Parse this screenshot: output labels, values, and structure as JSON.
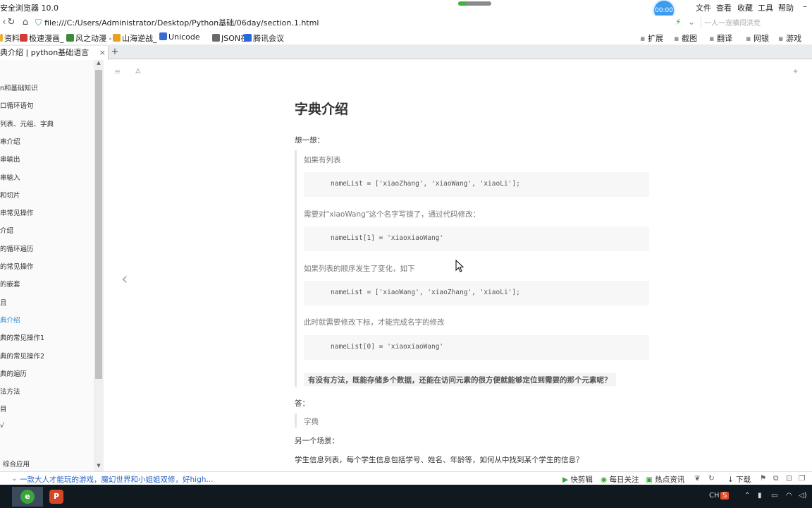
{
  "window": {
    "title": "安全浏览器 10.0",
    "timer": "00:00",
    "progress": 0.26,
    "menu": [
      "文件",
      "查看",
      "收藏",
      "工具",
      "帮助"
    ]
  },
  "nav": {
    "url": "file:///C:/Users/Administrator/Desktop/Python基础/06day/section.1.html",
    "search_placeholder": "一人一宠横闯洪荒"
  },
  "bookmarks": {
    "left": [
      {
        "label": "资料",
        "color": "#e8b22e"
      },
      {
        "label": "极速漫画_",
        "color": "#d43a3a"
      },
      {
        "label": "风之动漫 -",
        "color": "#3a8a3a"
      },
      {
        "label": "山海逆战_",
        "color": "#e8a020"
      },
      {
        "label": "Unicode",
        "color": "#3a6ad4"
      },
      {
        "label": "JSON在",
        "color": "#6a6a6a"
      },
      {
        "label": "腾讯会议",
        "color": "#2a6ad8"
      }
    ],
    "right": [
      "扩展",
      "截图",
      "翻译",
      "网银",
      "游戏"
    ]
  },
  "tab": {
    "label": "典介绍 | python基础语言",
    "close": "×",
    "new": "+"
  },
  "sidebar": {
    "items": [
      {
        "label": "n和基础知识",
        "active": false
      },
      {
        "label": "口循环语句",
        "active": false
      },
      {
        "label": "列表、元组、字典",
        "active": false
      },
      {
        "label": "串介绍",
        "active": false
      },
      {
        "label": "串输出",
        "active": false
      },
      {
        "label": "串输入",
        "active": false
      },
      {
        "label": "和切片",
        "active": false
      },
      {
        "label": "串常见操作",
        "active": false
      },
      {
        "label": "介绍",
        "active": false
      },
      {
        "label": "的循环遍历",
        "active": false
      },
      {
        "label": "的常见操作",
        "active": false
      },
      {
        "label": "的嵌套",
        "active": false
      },
      {
        "label": "且",
        "active": false
      },
      {
        "label": "典介绍",
        "active": true
      },
      {
        "label": "典的常见操作1",
        "active": false
      },
      {
        "label": "典的常见操作2",
        "active": false
      },
      {
        "label": "典的遍历",
        "active": false
      },
      {
        "label": "法方法",
        "active": false
      },
      {
        "label": "目",
        "active": false
      },
      {
        "label": "√",
        "active": false
      },
      {
        "label": "综合应用",
        "active": false
      }
    ]
  },
  "content": {
    "title": "字典介绍",
    "think": "想一想：",
    "q1": "如果有列表",
    "code1": "nameList = ['xiaoZhang', 'xiaoWang', 'xiaoLi'];",
    "q2": "需要对\"xiaoWang\"这个名字写错了，通过代码修改：",
    "code2": "nameList[1] = 'xiaoxiaoWang'",
    "q3": "如果列表的顺序发生了变化，如下",
    "code3": "nameList = ['xiaoWang', 'xiaoZhang',  'xiaoLi'];",
    "q4": "此时就需要修改下标，才能完成名字的修改",
    "code4": "nameList[0] = 'xiaoxiaoWang'",
    "question": "有没有方法，既能存储多个数据，还能在访问元素的很方便就能够定位到需要的那个元素呢？",
    "answer_label": "答：",
    "answer": "字典",
    "scene": "另一个场景：",
    "scene_text": "学生信息列表，每个学生信息包括学号、姓名、年龄等，如何从中找到某个学生的信息？"
  },
  "statusbar": {
    "ad": "一款大人才能玩的游戏，魔幻世界和小姐姐双修，好high...",
    "items": [
      "快剪辑",
      "每日关注",
      "热点资讯",
      "下载"
    ]
  },
  "taskbar": {
    "lang": "CH",
    "ime": "S"
  }
}
